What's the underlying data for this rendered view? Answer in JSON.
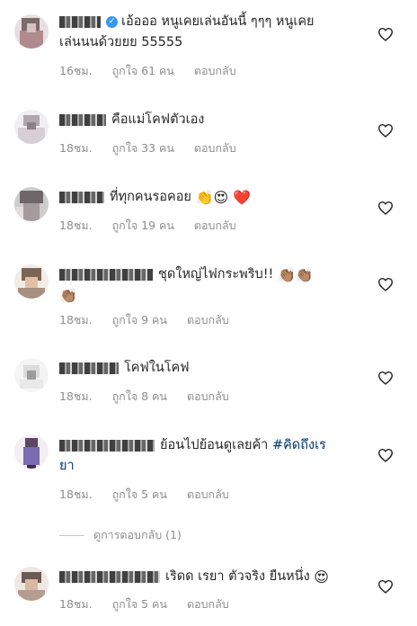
{
  "comments": [
    {
      "text_line1": "เอ้อออ หนูเคยเล่นอันนี้ ๆๆๆ หนูเคย",
      "text_line2": "เล่นนนด้วยยย 55555",
      "time": "16ชม.",
      "likes": "ถูกใจ 61 คน",
      "reply": "ตอบกลับ",
      "verified": true
    },
    {
      "text": "คือแม่โคฟตัวเอง",
      "time": "18ชม.",
      "likes": "ถูกใจ 33 คน",
      "reply": "ตอบกลับ"
    },
    {
      "text": "ที่ทุกคนรอคอย",
      "emojis": "👏😍 ❤️",
      "time": "18ชม.",
      "likes": "ถูกใจ 19 คน",
      "reply": "ตอบกลับ"
    },
    {
      "text": "ชุดใหญ่ไฟกระพริบ!!",
      "emojis": "👏🏽👏🏽",
      "emojis_line2": "👏🏽",
      "time": "18ชม.",
      "likes": "ถูกใจ 9 คน",
      "reply": "ตอบกลับ"
    },
    {
      "text": "โคฟในโคฟ",
      "time": "18ชม.",
      "likes": "ถูกใจ 8 คน",
      "reply": "ตอบกลับ"
    },
    {
      "text": "ย้อนไปย้อนดูเลยค้า",
      "hashtag": "#คิดถึงเร",
      "text_line2": "ยา",
      "time": "18ชม.",
      "likes": "ถูกใจ 5 คน",
      "reply": "ตอบกลับ"
    },
    {
      "text": "เริดด เรยา ตัวจริง ยืนหนึ่ง",
      "emojis": "😍",
      "time": "18ชม.",
      "likes": "ถูกใจ 5 คน",
      "reply": "ตอบกลับ"
    }
  ],
  "view_replies": "ดูการตอบกลับ (1)",
  "colors": {
    "text": "#262626",
    "meta": "#8e8e8e",
    "hashtag": "#003569",
    "verified": "#3897f0"
  }
}
